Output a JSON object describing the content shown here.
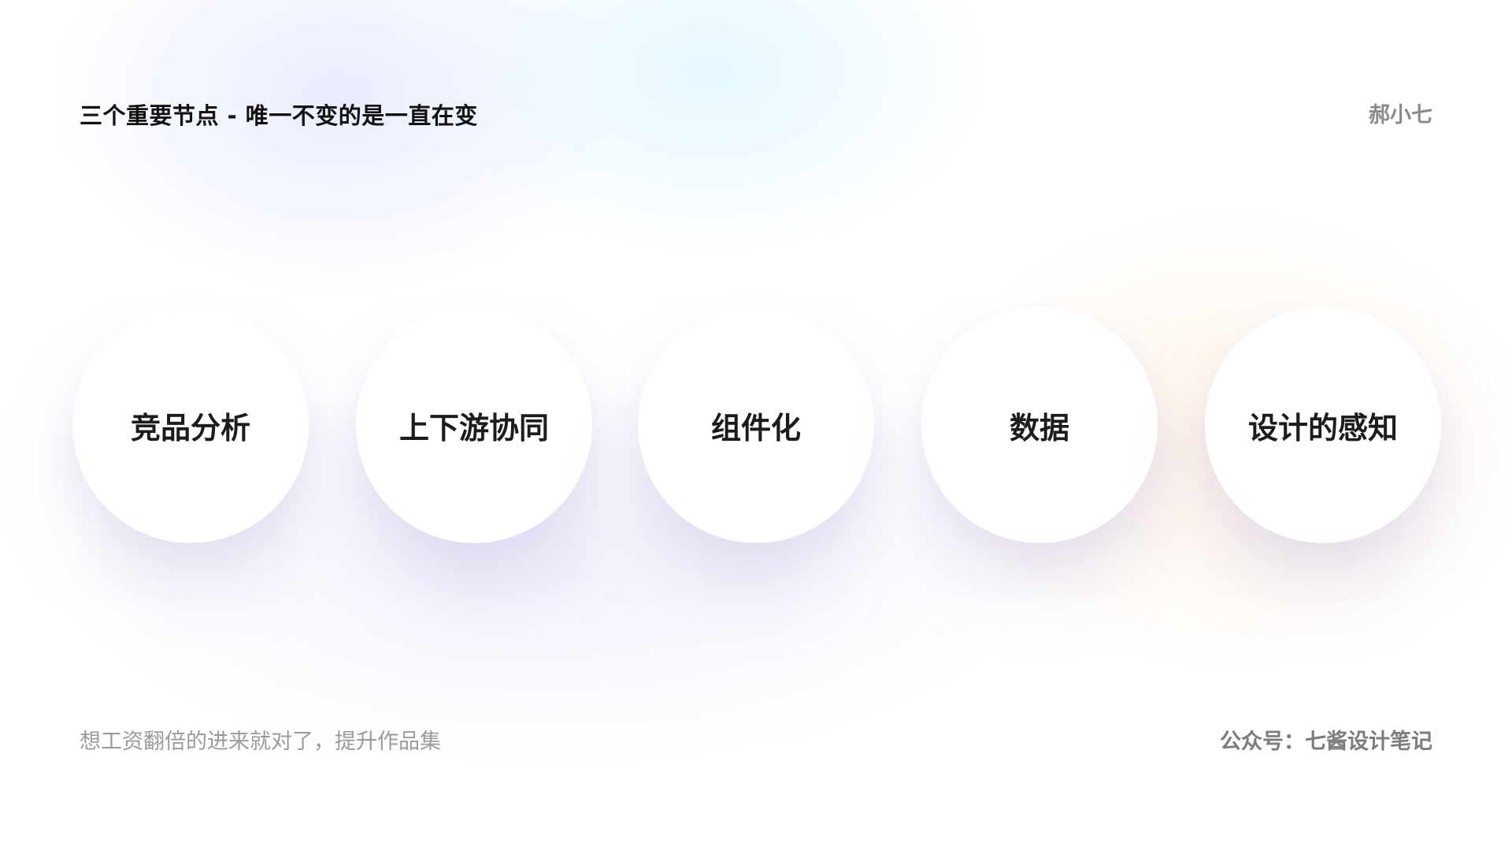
{
  "header": {
    "title": "三个重要节点 - 唯一不变的是一直在变",
    "author": "郝小七"
  },
  "nodes": [
    {
      "label": "竞品分析"
    },
    {
      "label": "上下游协同"
    },
    {
      "label": "组件化"
    },
    {
      "label": "数据"
    },
    {
      "label": "设计的感知"
    }
  ],
  "footer": {
    "left_text": "想工资翻倍的进来就对了，提升作品集",
    "right_text": "公众号：七酱设计笔记"
  },
  "colors": {
    "title": "#111111",
    "node_background": "#ffffff",
    "node_text": "#1c1c1c",
    "muted_text": "#9a9a9a"
  }
}
